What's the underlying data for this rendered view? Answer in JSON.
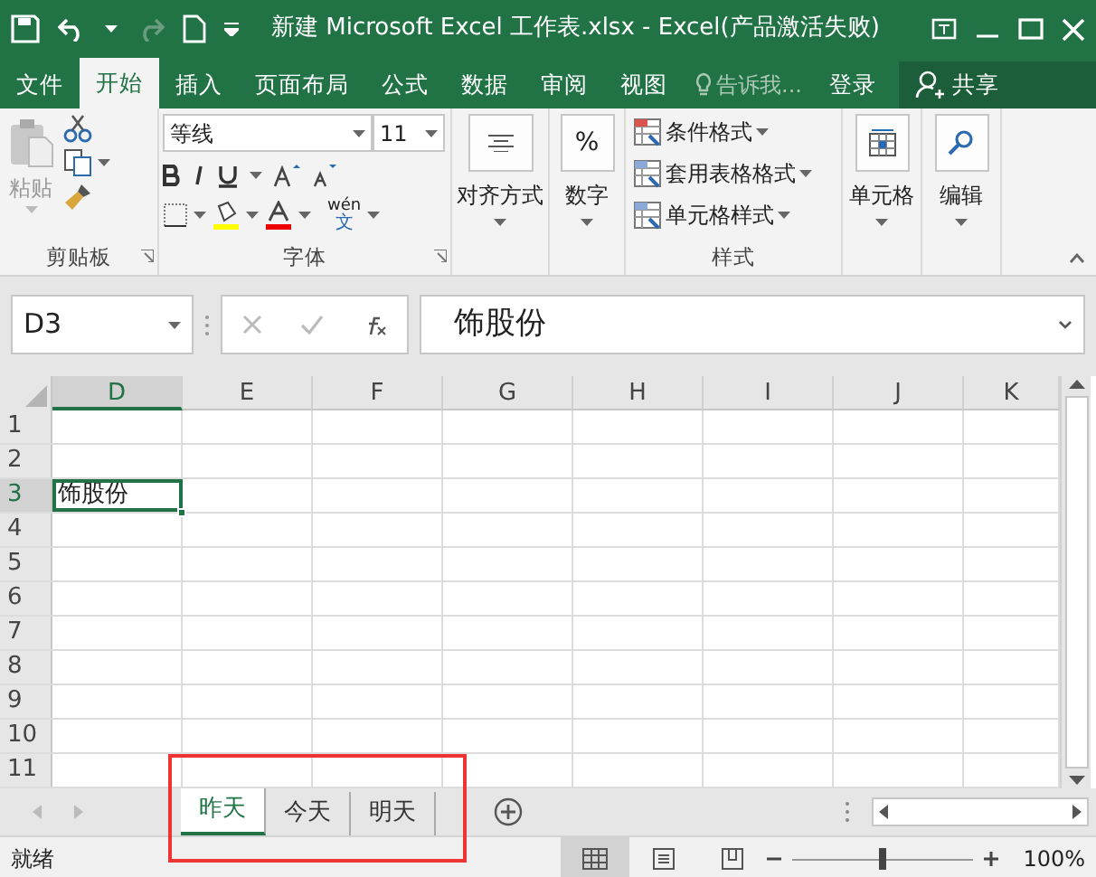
{
  "window": {
    "title": "新建 Microsoft Excel 工作表.xlsx - Excel(产品激活失败)"
  },
  "ribbon_tabs": [
    {
      "label": "文件",
      "selected": false
    },
    {
      "label": "开始",
      "selected": true
    },
    {
      "label": "插入",
      "selected": false
    },
    {
      "label": "页面布局",
      "selected": false
    },
    {
      "label": "公式",
      "selected": false
    },
    {
      "label": "数据",
      "selected": false
    },
    {
      "label": "审阅",
      "selected": false
    },
    {
      "label": "视图",
      "selected": false
    }
  ],
  "tell_me": {
    "placeholder": "告诉我..."
  },
  "sign_in": "登录",
  "share": "共享",
  "ribbon": {
    "clipboard": {
      "paste": "粘贴",
      "label": "剪贴板"
    },
    "font": {
      "font_name": "等线",
      "font_size": "11",
      "phonetic": "wén",
      "phonetic_char": "文",
      "label": "字体"
    },
    "alignment": {
      "label": "对齐方式"
    },
    "number": {
      "symbol": "%",
      "label": "数字"
    },
    "styles": {
      "items": [
        "条件格式",
        "套用表格格式",
        "单元格样式"
      ],
      "label": "样式"
    },
    "cells": {
      "label": "单元格"
    },
    "editing": {
      "label": "编辑"
    }
  },
  "formula_bar": {
    "name_box": "D3",
    "content": "饰股份"
  },
  "grid": {
    "columns": [
      {
        "label": "D",
        "selected": true
      },
      {
        "label": "E",
        "selected": false
      },
      {
        "label": "F",
        "selected": false
      },
      {
        "label": "G",
        "selected": false
      },
      {
        "label": "H",
        "selected": false
      },
      {
        "label": "I",
        "selected": false
      },
      {
        "label": "J",
        "selected": false
      },
      {
        "label": "K",
        "selected": false
      }
    ],
    "rows": [
      {
        "label": "1",
        "selected": false
      },
      {
        "label": "2",
        "selected": false
      },
      {
        "label": "3",
        "selected": true,
        "value": "饰股份"
      },
      {
        "label": "4",
        "selected": false
      },
      {
        "label": "5",
        "selected": false
      },
      {
        "label": "6",
        "selected": false
      },
      {
        "label": "7",
        "selected": false
      },
      {
        "label": "8",
        "selected": false
      },
      {
        "label": "9",
        "selected": false
      },
      {
        "label": "10",
        "selected": false
      },
      {
        "label": "11",
        "selected": false
      }
    ]
  },
  "sheet_tabs": [
    {
      "label": "昨天",
      "selected": true
    },
    {
      "label": "今天",
      "selected": false
    },
    {
      "label": "明天",
      "selected": false
    }
  ],
  "status_bar": {
    "status": "就绪",
    "zoom": "100%",
    "zoom_level": {
      "level": 0.5
    }
  }
}
